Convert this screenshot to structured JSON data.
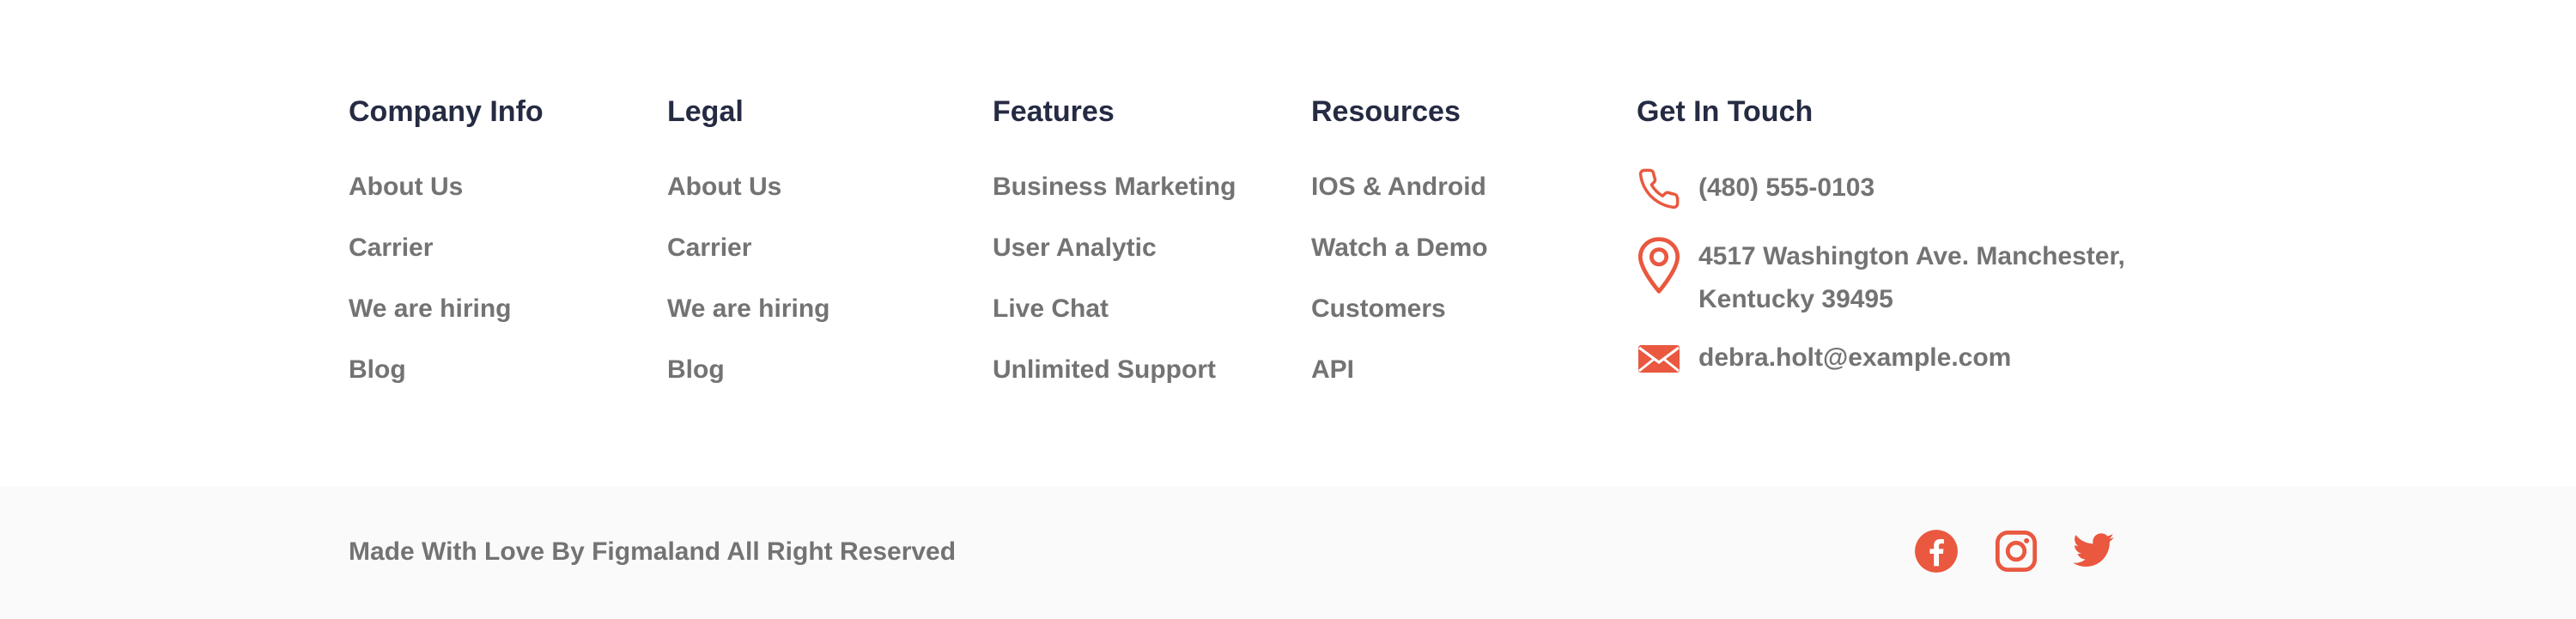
{
  "columns": [
    {
      "title": "Company Info",
      "links": [
        "About Us",
        "Carrier",
        "We are hiring",
        "Blog"
      ]
    },
    {
      "title": "Legal",
      "links": [
        "About Us",
        "Carrier",
        "We are hiring",
        "Blog"
      ]
    },
    {
      "title": "Features",
      "links": [
        "Business Marketing",
        "User Analytic",
        "Live Chat",
        "Unlimited Support"
      ]
    },
    {
      "title": "Resources",
      "links": [
        "IOS & Android",
        "Watch a Demo",
        "Customers",
        "API"
      ]
    }
  ],
  "contact": {
    "title": "Get In Touch",
    "phone": "(480) 555-0103",
    "address_line1": "4517 Washington Ave. Manchester,",
    "address_line2": "Kentucky 39495",
    "email": "debra.holt@example.com",
    "icons": [
      "phone-icon",
      "location-pin-icon",
      "mail-icon"
    ]
  },
  "bottom": {
    "copyright": "Made With Love By Figmaland All Right Reserved",
    "social": [
      "facebook-icon",
      "instagram-icon",
      "twitter-icon"
    ]
  },
  "colors": {
    "accent": "#E9583F",
    "heading": "#252B42",
    "text": "#737373",
    "bottom_bg": "#FAFAFA"
  }
}
